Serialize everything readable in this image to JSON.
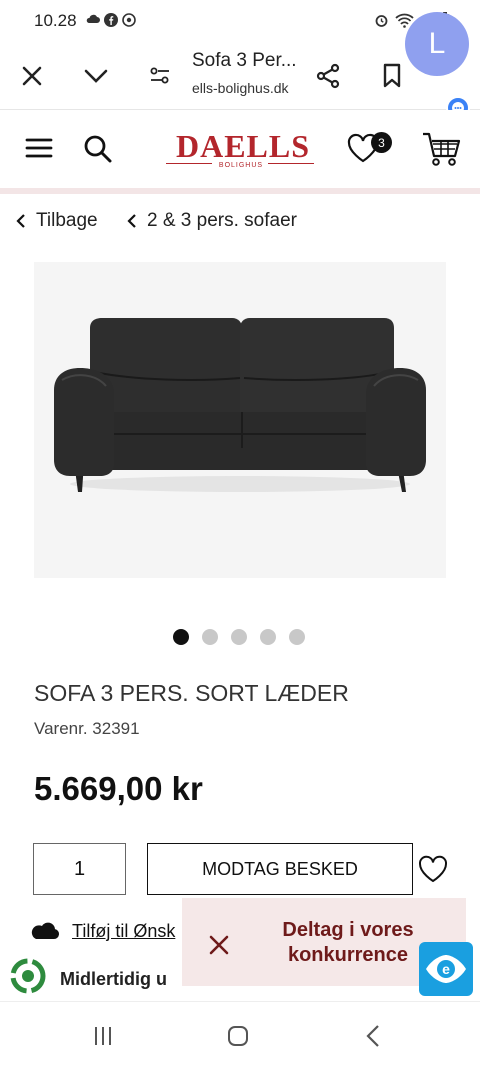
{
  "status_bar": {
    "time": "10.28",
    "left_icons": [
      "cloud-icon",
      "facebook-icon",
      "chrome-icon"
    ],
    "right_icons": [
      "alarm-icon",
      "wifi-icon",
      "signal-icon",
      "battery-icon"
    ]
  },
  "browser": {
    "tab_title": "Sofa 3 Per...",
    "url": "ells-bolighus.dk",
    "avatar_letter": "L",
    "buttons": [
      "close-icon",
      "chevron-down-icon",
      "page-settings-icon",
      "share-icon",
      "bookmark-icon"
    ]
  },
  "site_header": {
    "logo": "DAELLS",
    "logo_sub": "BOLIGHUS",
    "wishlist_count": "3",
    "brand_color": "#b3262c"
  },
  "breadcrumbs": {
    "back": "Tilbage",
    "category": "2 & 3 pers. sofaer"
  },
  "product": {
    "title": "SOFA 3 PERS. SORT LÆDER",
    "sku_label": "Varenr.",
    "sku": "32391",
    "price": "5.669,00 kr",
    "image_count": 5,
    "active_image": 0,
    "quantity": "1",
    "notify_label": "MODTAG BESKED",
    "wishlist_link": "Tilføj til Ønsk",
    "temporary_text": "Midlertidig u"
  },
  "promo": {
    "text_line1": "Deltag i vores",
    "text_line2": "konkurrence"
  },
  "colors": {
    "promo_bg": "#f5e8e8",
    "promo_text": "#6e1a1a",
    "emaerket": "#1a9fe0"
  }
}
